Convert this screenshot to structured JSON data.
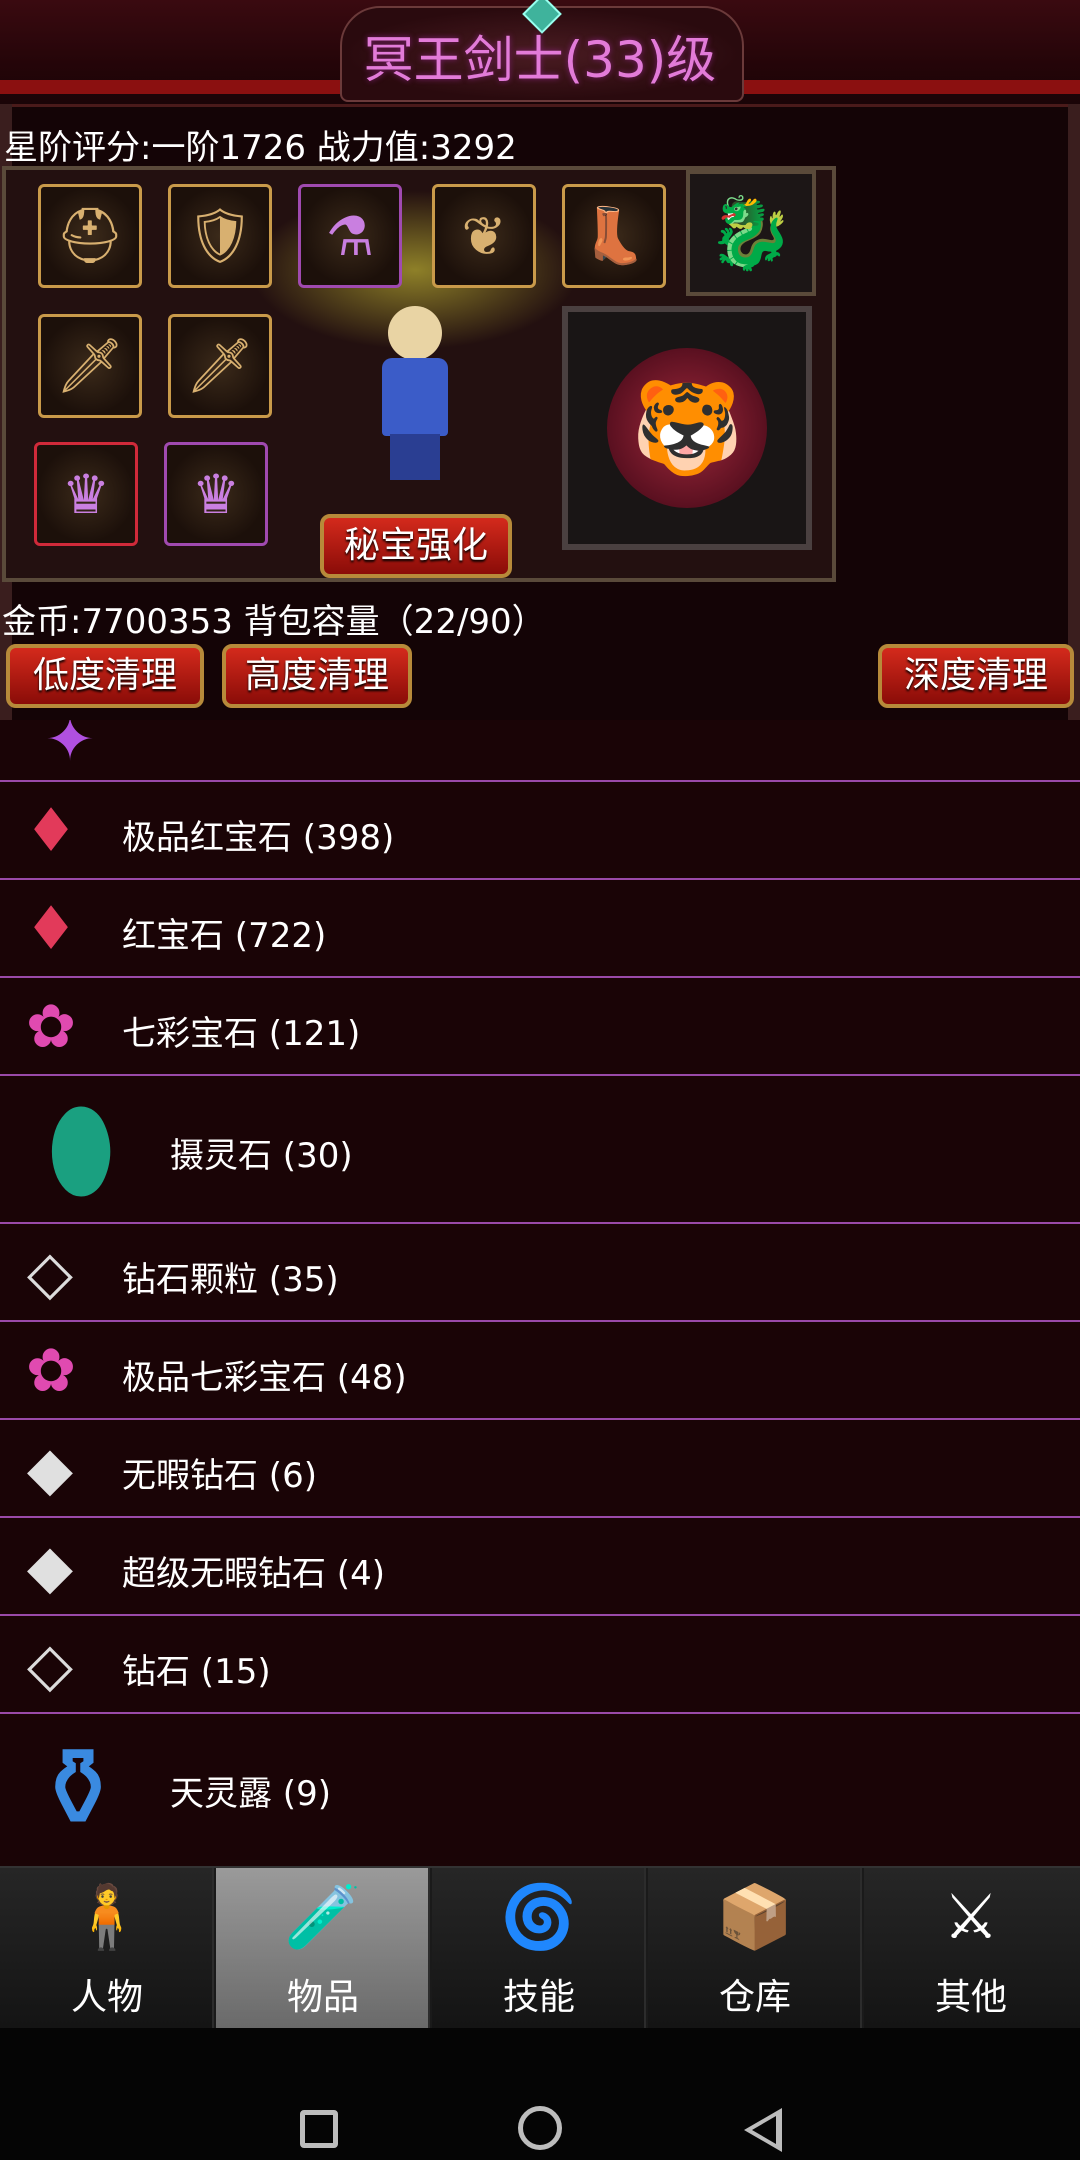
{
  "header": {
    "title": "冥王剑士(33)级"
  },
  "stats": {
    "rating": "星阶评分:一阶1726 战力值:3292"
  },
  "equipment": {
    "slots": [
      {
        "icon": "helmet-icon",
        "glyph": "⛑"
      },
      {
        "icon": "armor-icon",
        "glyph": "🛡"
      },
      {
        "icon": "potion-icon",
        "glyph": "⚗"
      },
      {
        "icon": "wing-icon",
        "glyph": "❦"
      },
      {
        "icon": "boots-icon",
        "glyph": "👢"
      },
      {
        "icon": "sword-icon",
        "glyph": "🗡"
      },
      {
        "icon": "sword-icon",
        "glyph": "🗡"
      },
      {
        "icon": "crown-icon",
        "glyph": "♛"
      },
      {
        "icon": "crown-icon",
        "glyph": "♛"
      }
    ],
    "mount_glyph": "🐉",
    "pet_glyph": "🐯",
    "enhance_button": "秘宝强化"
  },
  "inventory": {
    "summary": "金币:7700353 背包容量（22/90）",
    "buttons": {
      "low": "低度清理",
      "high": "高度清理",
      "deep": "深度清理"
    },
    "items": [
      {
        "label": "",
        "glyph": "✦",
        "color": "#b050e0"
      },
      {
        "label": "极品红宝石 (398)",
        "glyph": "♦",
        "color": "#e23a5a"
      },
      {
        "label": "红宝石 (722)",
        "glyph": "♦",
        "color": "#e23a5a"
      },
      {
        "label": "七彩宝石 (121)",
        "glyph": "✿",
        "color": "#e04ab0"
      },
      {
        "label": "摄灵石 (30)",
        "glyph": "⬮",
        "color": "#1aa080"
      },
      {
        "label": "钻石颗粒 (35)",
        "glyph": "◇",
        "color": "#dcdcdc"
      },
      {
        "label": "极品七彩宝石 (48)",
        "glyph": "✿",
        "color": "#e04ab0"
      },
      {
        "label": "无暇钻石 (6)",
        "glyph": "◆",
        "color": "#e0e0e0"
      },
      {
        "label": "超级无暇钻石 (4)",
        "glyph": "◆",
        "color": "#e0e0e0"
      },
      {
        "label": "钻石 (15)",
        "glyph": "◇",
        "color": "#dcdcdc"
      },
      {
        "label": "天灵露 (9)",
        "glyph": "⚱",
        "color": "#3a8ae0"
      }
    ]
  },
  "tabs": [
    {
      "label": "人物",
      "glyph": "🧍"
    },
    {
      "label": "物品",
      "glyph": "🧪"
    },
    {
      "label": "技能",
      "glyph": "🌀"
    },
    {
      "label": "仓库",
      "glyph": "📦"
    },
    {
      "label": "其他",
      "glyph": "⚔"
    }
  ],
  "colors": {
    "accent_title": "#e27bd8",
    "row_divider": "#9a4aa8",
    "button_red": "#b81a10"
  }
}
